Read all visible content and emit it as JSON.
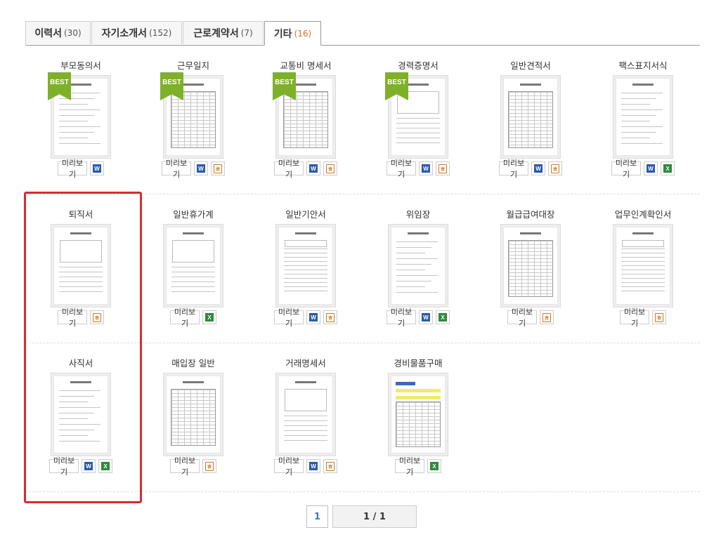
{
  "tabs": [
    {
      "label": "이력서",
      "count": "(30)",
      "active": false
    },
    {
      "label": "자기소개서",
      "count": "(152)",
      "active": false
    },
    {
      "label": "근로계약서",
      "count": "(7)",
      "active": false
    },
    {
      "label": "기타",
      "count": "(16)",
      "active": true
    }
  ],
  "common": {
    "preview_label": "미리보기",
    "best_label": "BEST"
  },
  "items": [
    {
      "title": "부모동의서",
      "best": true,
      "formats": [
        "word"
      ],
      "style": "text"
    },
    {
      "title": "근무일지",
      "best": true,
      "formats": [
        "word",
        "hwp"
      ],
      "style": "grid"
    },
    {
      "title": "교통비 명세서",
      "best": true,
      "formats": [
        "word",
        "hwp"
      ],
      "style": "grid"
    },
    {
      "title": "경력증명서",
      "best": true,
      "formats": [
        "word",
        "hwp"
      ],
      "style": "form"
    },
    {
      "title": "일반견적서",
      "best": false,
      "formats": [
        "word",
        "hwp"
      ],
      "style": "grid"
    },
    {
      "title": "팩스표지서식",
      "best": false,
      "formats": [
        "word",
        "excel"
      ],
      "style": "text"
    },
    {
      "title": "퇴직서",
      "best": false,
      "formats": [
        "hwp"
      ],
      "style": "form"
    },
    {
      "title": "일반휴가계",
      "best": false,
      "formats": [
        "excel"
      ],
      "style": "form"
    },
    {
      "title": "일반기안서",
      "best": false,
      "formats": [
        "word",
        "hwp"
      ],
      "style": "lines"
    },
    {
      "title": "위임장",
      "best": false,
      "formats": [
        "word",
        "excel"
      ],
      "style": "text"
    },
    {
      "title": "월급급여대장",
      "best": false,
      "formats": [
        "hwp"
      ],
      "style": "grid"
    },
    {
      "title": "업무인계확인서",
      "best": false,
      "formats": [
        "hwp"
      ],
      "style": "lines"
    },
    {
      "title": "사직서",
      "best": false,
      "formats": [
        "word",
        "excel"
      ],
      "style": "text"
    },
    {
      "title": "매입장 일반",
      "best": false,
      "formats": [
        "hwp"
      ],
      "style": "grid"
    },
    {
      "title": "거래명세서",
      "best": false,
      "formats": [
        "word",
        "hwp"
      ],
      "style": "form"
    },
    {
      "title": "경비물품구매",
      "best": false,
      "formats": [
        "excel"
      ],
      "style": "color"
    }
  ],
  "pagination": {
    "current": "1",
    "summary": "1 / 1"
  },
  "colors": {
    "accent_highlight": "#d72c32",
    "best_ribbon": "#7fb02a",
    "active_count": "#e07020"
  }
}
